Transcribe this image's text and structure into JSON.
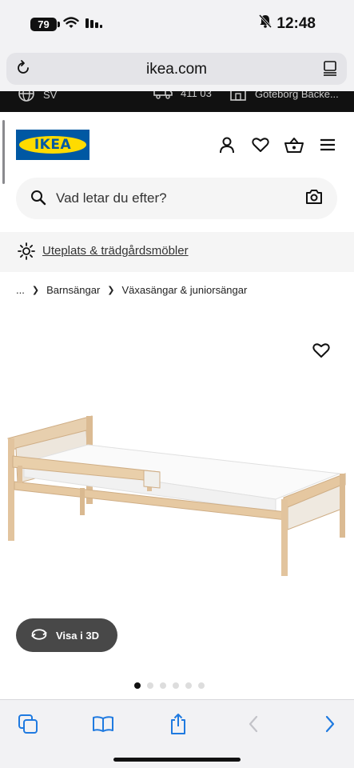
{
  "status_bar": {
    "battery": "79",
    "time": "12:48",
    "icons": [
      "wifi-icon",
      "signal-icon",
      "bell-slash-icon"
    ]
  },
  "browser": {
    "url": "ikea.com"
  },
  "utility_bar": {
    "language": "SV",
    "postcode": "411 03",
    "store": "Göteborg Bäcke..."
  },
  "header": {
    "logo_text": "IKEA",
    "icons": [
      "user-icon",
      "heart-icon",
      "basket-icon",
      "menu-icon"
    ]
  },
  "search": {
    "placeholder": "Vad letar du efter?"
  },
  "promo": {
    "link": "Uteplats & trädgårdsmöbler"
  },
  "breadcrumb": {
    "ellipsis": "...",
    "items": [
      "Barnsängar",
      "Växasängar & juniorsängar"
    ]
  },
  "product": {
    "view3d_label": "Visa i 3D",
    "carousel_total": 6,
    "carousel_active": 1
  },
  "colors": {
    "ikea_blue": "#0058a3",
    "ikea_yellow": "#ffdb00",
    "view3d_bg": "#484848",
    "safari_blue": "#1f7ae0"
  }
}
